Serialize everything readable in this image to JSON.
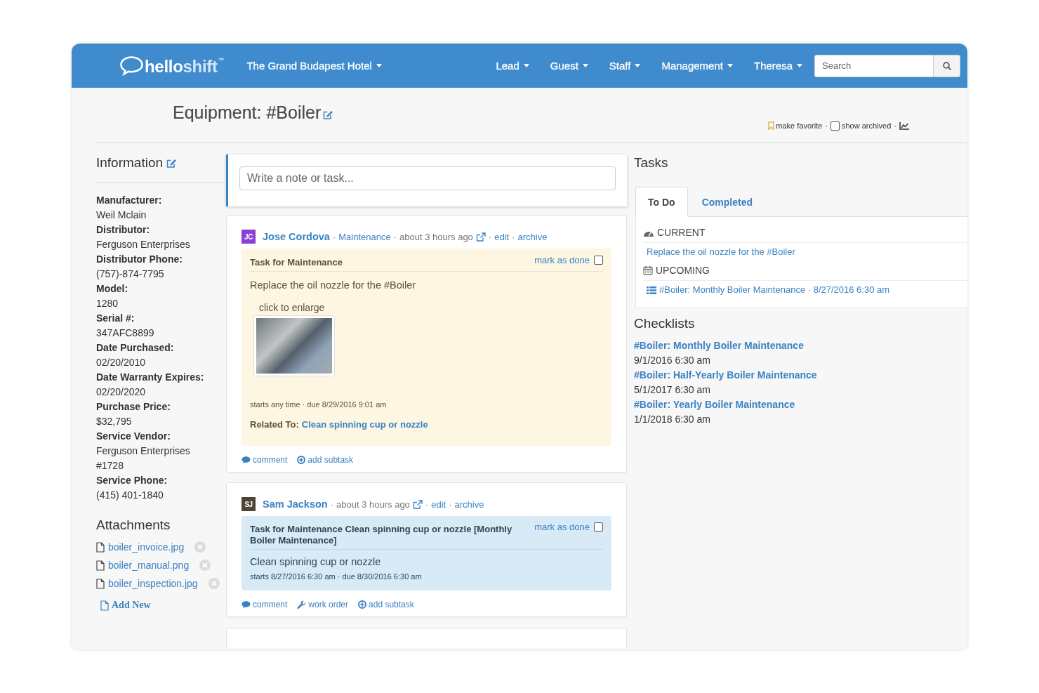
{
  "navbar": {
    "logo": {
      "strong": "hello",
      "light": "shift",
      "mark": "™"
    },
    "hotel": "The Grand Budapest Hotel",
    "menus": [
      "Lead",
      "Guest",
      "Staff",
      "Management",
      "Theresa"
    ],
    "search": {
      "placeholder": "Search"
    }
  },
  "page_header": {
    "title": "Equipment: #Boiler",
    "actions": [
      {
        "kind": "favorite",
        "text": "make favorite"
      },
      {
        "kind": "separator",
        "text": "·"
      },
      {
        "kind": "checkbox",
        "text": "show archived",
        "checked": false
      },
      {
        "kind": "separator",
        "text": "·"
      },
      {
        "kind": "chart"
      }
    ]
  },
  "information": {
    "title": "Information",
    "fields": [
      {
        "label": "Manufacturer:",
        "value": "Weil Mclain"
      },
      {
        "label": "Distributor:",
        "value": "Ferguson Enterprises"
      },
      {
        "label": "Distributor Phone:",
        "value": "(757)-874-7795"
      },
      {
        "label": "Model:",
        "value": "1280"
      },
      {
        "label": "Serial #:",
        "value": "347AFC8899"
      },
      {
        "label": "Date Purchased:",
        "value": "02/20/2010"
      },
      {
        "label": "Date Warranty Expires:",
        "value": "02/20/2020"
      },
      {
        "label": "Purchase Price:",
        "value": "$32,795"
      },
      {
        "label": "Service Vendor:",
        "value": "Ferguson Enterprises #1728"
      },
      {
        "label": "Service Phone:",
        "value": "(415) 401-1840"
      }
    ]
  },
  "attachments": {
    "title": "Attachments",
    "files": [
      "boiler_invoice.jpg",
      "boiler_manual.png",
      "boiler_inspection.jpg"
    ],
    "add_new": "Add New"
  },
  "composer": {
    "placeholder": "Write a note or task..."
  },
  "feed": {
    "posts": [
      {
        "initials": "JC",
        "color": "#8b3fd4",
        "byline": [
          {
            "kind": "author",
            "text": "Jose Cordova"
          },
          {
            "kind": "separator",
            "text": "·"
          },
          {
            "kind": "category",
            "text": "Maintenance"
          },
          {
            "kind": "separator",
            "text": "·"
          },
          {
            "kind": "time",
            "text": "about 3 hours ago"
          },
          {
            "kind": "external_link"
          },
          {
            "kind": "separator",
            "text": "·"
          },
          {
            "kind": "edit",
            "text": "edit"
          },
          {
            "kind": "separator",
            "text": "·"
          },
          {
            "kind": "archive",
            "text": "archive"
          }
        ],
        "task": {
          "color": "#fcf6e2",
          "title": "Task for Maintenance",
          "mark_done": {
            "label": "mark as done",
            "checked": false
          },
          "description": "Replace the oil nozzle for the #Boiler",
          "image": {
            "caption": "click to enlarge"
          },
          "schedule": "starts any time · due 8/29/2016 9:01 am",
          "related": {
            "label": "Related To:",
            "link": "Clean spinning cup or nozzle"
          }
        },
        "footer": [
          {
            "kind": "comment",
            "text": "comment"
          },
          {
            "kind": "subtask",
            "text": "add subtask"
          }
        ]
      },
      {
        "initials": "SJ",
        "color": "#4e4437",
        "byline": [
          {
            "kind": "author",
            "text": "Sam Jackson"
          },
          {
            "kind": "separator",
            "text": "·"
          },
          {
            "kind": "time",
            "text": "about 3 hours ago"
          },
          {
            "kind": "external_link"
          },
          {
            "kind": "separator",
            "text": "·"
          },
          {
            "kind": "edit",
            "text": "edit"
          },
          {
            "kind": "separator",
            "text": "·"
          },
          {
            "kind": "archive",
            "text": "archive"
          }
        ],
        "task": {
          "color": "#d9eaf7",
          "title": "Task for Maintenance Clean spinning cup or nozzle [Monthly Boiler Maintenance]",
          "mark_done": {
            "label": "mark as done",
            "checked": false
          },
          "description": "Clean spinning cup or nozzle",
          "schedule": "starts 8/27/2016 6:30 am · due 8/30/2016 6:30 am"
        },
        "footer": [
          {
            "kind": "comment",
            "text": "comment"
          },
          {
            "kind": "work_order",
            "text": "work order"
          },
          {
            "kind": "subtask",
            "text": "add subtask"
          }
        ]
      }
    ],
    "cut_off_post": true
  },
  "tasks": {
    "title": "Tasks",
    "tabs": [
      {
        "label": "To Do",
        "selected": true
      },
      {
        "label": "Completed",
        "selected": false
      }
    ],
    "sections": [
      {
        "kind": "current",
        "heading": "CURRENT",
        "items": [
          {
            "kind": "task",
            "text": "Replace the oil nozzle for the #Boiler"
          }
        ]
      },
      {
        "kind": "upcoming",
        "heading": "UPCOMING",
        "items": [
          {
            "kind": "checklist",
            "text": "#Boiler: Monthly Boiler Maintenance · 8/27/2016 6:30 am"
          }
        ]
      }
    ]
  },
  "checklists": {
    "title": "Checklists",
    "items": [
      {
        "name": "#Boiler: Monthly Boiler Maintenance",
        "date": "9/1/2016 6:30 am"
      },
      {
        "name": "#Boiler: Half-Yearly Boiler Maintenance",
        "date": "5/1/2017 6:30 am"
      },
      {
        "name": "#Boiler: Yearly Boiler Maintenance",
        "date": "1/1/2018 6:30 am"
      }
    ]
  }
}
